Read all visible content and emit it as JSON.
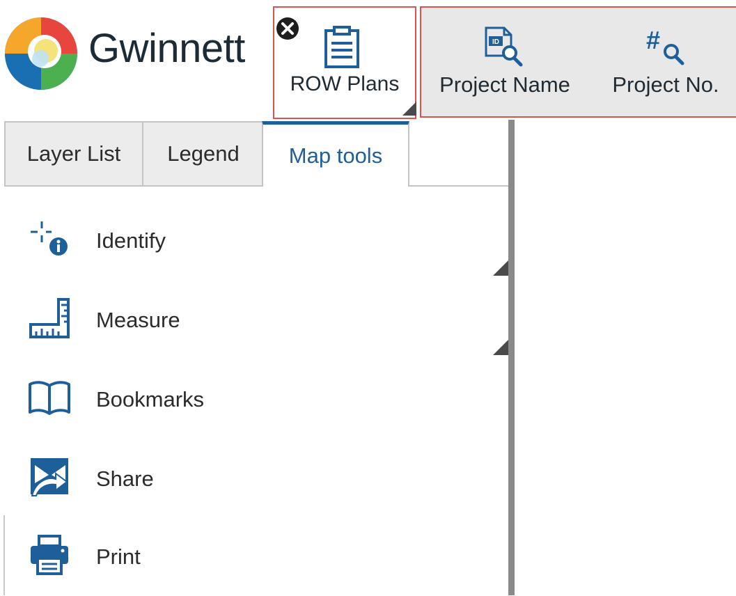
{
  "header": {
    "logo_text": "Gwinnett",
    "row_plans": {
      "label": "ROW Plans"
    },
    "search_buttons": [
      {
        "label": "Project Name"
      },
      {
        "label": "Project No."
      }
    ]
  },
  "tabs": [
    {
      "label": "Layer List",
      "active": false
    },
    {
      "label": "Legend",
      "active": false
    },
    {
      "label": "Map tools",
      "active": true
    }
  ],
  "tools": [
    {
      "label": "Identify",
      "icon": "identify-icon"
    },
    {
      "label": "Measure",
      "icon": "ruler-icon"
    },
    {
      "label": "Bookmarks",
      "icon": "book-icon"
    },
    {
      "label": "Share",
      "icon": "share-icon"
    },
    {
      "label": "Print",
      "icon": "printer-icon"
    }
  ],
  "colors": {
    "accent": "#1f5f99",
    "highlight_border": "#d9534f",
    "tab_bg": "#ececec",
    "toolbar_bg": "#e8e8e8"
  }
}
